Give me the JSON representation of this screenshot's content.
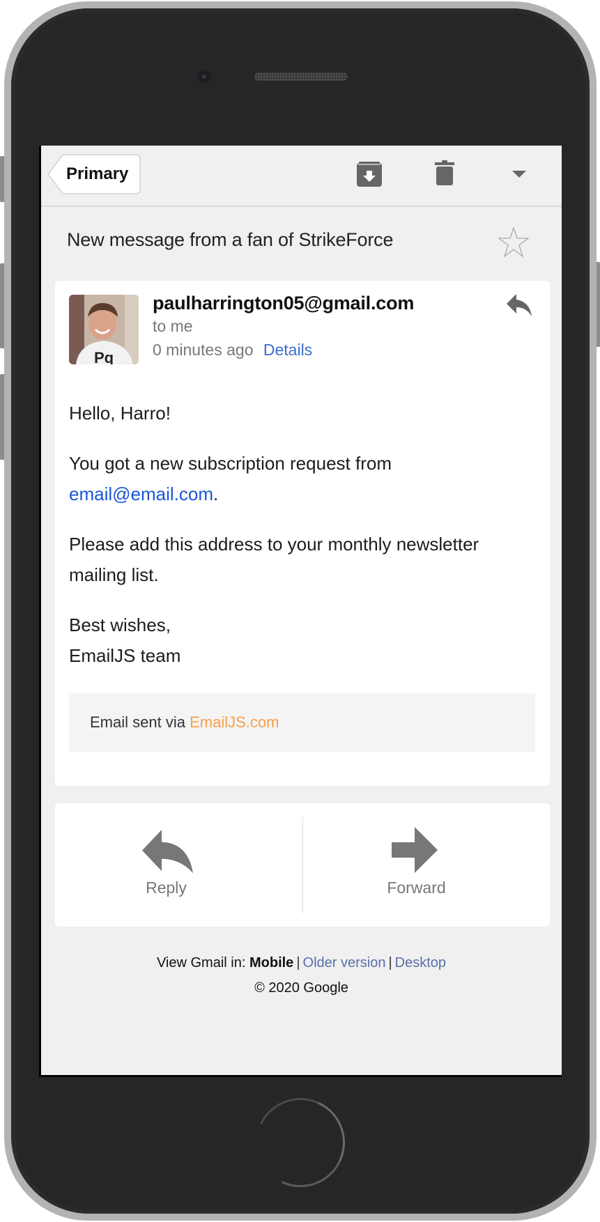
{
  "toolbar": {
    "back_label": "Primary",
    "icons": [
      "archive-icon",
      "trash-icon",
      "dropdown-icon"
    ]
  },
  "subject": "New message from a fan of StrikeForce",
  "message": {
    "sender": "paulharrington05@gmail.com",
    "recipient": "to me",
    "time": "0 minutes ago",
    "details_label": "Details",
    "body": {
      "greeting": "Hello, Harro!",
      "line1_prefix": "You got a new subscription request from",
      "line1_link": "email@email.com",
      "line1_suffix": ".",
      "line2": "Please add this address to your monthly newsletter mailing list.",
      "signoff": "Best wishes,",
      "signature": "EmailJS team"
    },
    "sent_via_prefix": "Email sent via",
    "sent_via_link": "EmailJS.com"
  },
  "actions": {
    "reply_label": "Reply",
    "forward_label": "Forward"
  },
  "footer": {
    "view_prefix": "View Gmail in:",
    "mobile": "Mobile",
    "older": "Older version",
    "desktop": "Desktop",
    "separator": "|",
    "copyright": "© 2020 Google"
  },
  "colors": {
    "link_blue": "#1a56d6",
    "details_blue": "#3b6fd0",
    "emailjs_orange": "#f7a048",
    "footer_link": "#5870a8",
    "icon_gray": "#666666"
  }
}
